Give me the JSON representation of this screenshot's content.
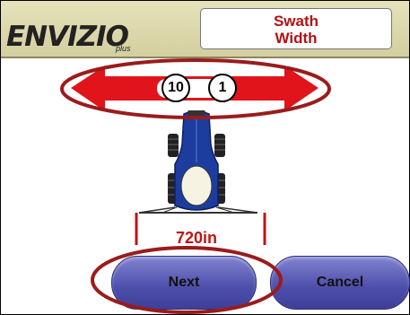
{
  "header": {
    "logo_text": "ENVIZIO",
    "logo_suffix": "plus",
    "title_line1": "Swath",
    "title_line2": "Width"
  },
  "width_selector": {
    "left_increment": "10",
    "right_increment": "1",
    "value": "720in"
  },
  "buttons": {
    "next_label": "Next",
    "cancel_label": "Cancel"
  },
  "colors": {
    "arrow_red": "#e0141a",
    "header_bg": "#ddd9ad",
    "title_text": "#b31212",
    "button_blue": "#5556b3",
    "tractor_blue": "#1d3d9e",
    "annotation_red": "#9b1b1b"
  }
}
